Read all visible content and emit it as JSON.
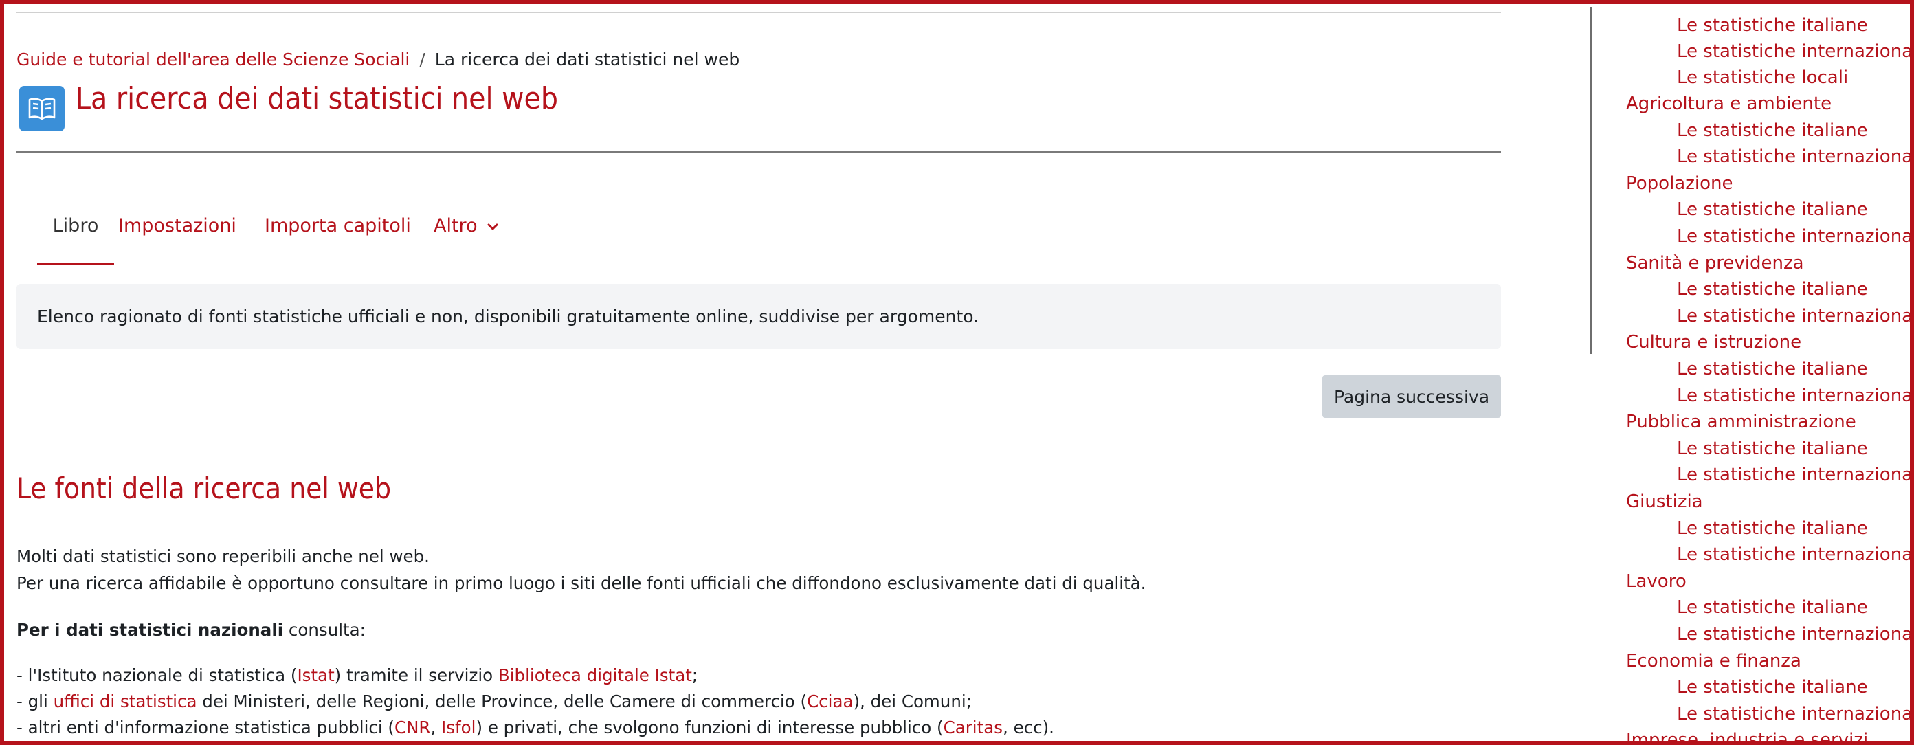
{
  "breadcrumb": {
    "parent": "Guide e tutorial dell'area delle Scienze Sociali",
    "separator": "/",
    "current": "La ricerca dei dati statistici nel web"
  },
  "page": {
    "title": "La ricerca dei dati statistici nel web",
    "icon": "book-icon",
    "summary": "Elenco ragionato di fonti statistiche ufficiali e non, disponibili gratuitamente online, suddivise per argomento.",
    "next_button": "Pagina successiva",
    "section_title": "Le fonti della ricerca nel web"
  },
  "tabs": [
    {
      "label": "Libro",
      "active": true
    },
    {
      "label": "Impostazioni",
      "active": false
    },
    {
      "label": "Importa capitoli",
      "active": false
    },
    {
      "label": "Altro",
      "active": false,
      "icon": "chevron-down-icon"
    }
  ],
  "content": {
    "p1": "Molti dati statistici sono reperibili anche nel web.",
    "p2": "Per una ricerca affidabile è opportuno consultare in primo luogo i siti delle fonti ufficiali che diffondono esclusivamente dati di qualità.",
    "national_bold": "Per i dati statistici nazionali",
    "national_rest": " consulta:",
    "li1": {
      "t1": "- l'Istituto nazionale di statistica (",
      "l1": "Istat",
      "t2": ") tramite il servizio ",
      "l2": "Biblioteca digitale Istat",
      "t3": ";"
    },
    "li2": {
      "t1": "- gli ",
      "l1": "uffici di statistica",
      "t2": " dei Ministeri, delle Regioni, delle Province, delle Camere di commercio (",
      "l2": "Cciaa",
      "t3": "), dei Comuni;"
    },
    "li3": {
      "t1": "- altri enti d'informazione statistica pubblici (",
      "l1": "CNR",
      "t2": ", ",
      "l2": "Isfol",
      "t3": ") e privati, che svolgono funzioni di interesse pubblico (",
      "l3": "Caritas",
      "t4": ", ecc)."
    }
  },
  "toc": [
    {
      "label": "Le statistiche italiane",
      "sub": true
    },
    {
      "label": "Le statistiche internazionali",
      "sub": true
    },
    {
      "label": "Le statistiche locali",
      "sub": true
    },
    {
      "label": "Agricoltura e ambiente",
      "sub": false
    },
    {
      "label": "Le statistiche italiane",
      "sub": true
    },
    {
      "label": "Le statistiche internazionali",
      "sub": true
    },
    {
      "label": "Popolazione",
      "sub": false
    },
    {
      "label": "Le statistiche italiane",
      "sub": true
    },
    {
      "label": "Le statistiche internazionali",
      "sub": true
    },
    {
      "label": "Sanità e previdenza",
      "sub": false
    },
    {
      "label": "Le statistiche italiane",
      "sub": true
    },
    {
      "label": "Le statistiche internazionali",
      "sub": true
    },
    {
      "label": "Cultura e istruzione",
      "sub": false
    },
    {
      "label": "Le statistiche italiane",
      "sub": true
    },
    {
      "label": "Le statistiche internazionali",
      "sub": true
    },
    {
      "label": "Pubblica amministrazione",
      "sub": false
    },
    {
      "label": "Le statistiche italiane",
      "sub": true
    },
    {
      "label": "Le statistiche internazionali",
      "sub": true
    },
    {
      "label": "Giustizia",
      "sub": false
    },
    {
      "label": "Le statistiche italiane",
      "sub": true
    },
    {
      "label": "Le statistiche internazionali",
      "sub": true
    },
    {
      "label": "Lavoro",
      "sub": false
    },
    {
      "label": "Le statistiche italiane",
      "sub": true
    },
    {
      "label": "Le statistiche internazionali",
      "sub": true
    },
    {
      "label": "Economia e finanza",
      "sub": false
    },
    {
      "label": "Le statistiche italiane",
      "sub": true
    },
    {
      "label": "Le statistiche internazionali",
      "sub": true
    },
    {
      "label": "Imprese, industria e servizi",
      "sub": false
    }
  ],
  "colors": {
    "accent": "#b5121b",
    "icon_bg": "#3a8fd8",
    "summary_bg": "#f3f4f6",
    "button_bg": "#ced4da"
  }
}
